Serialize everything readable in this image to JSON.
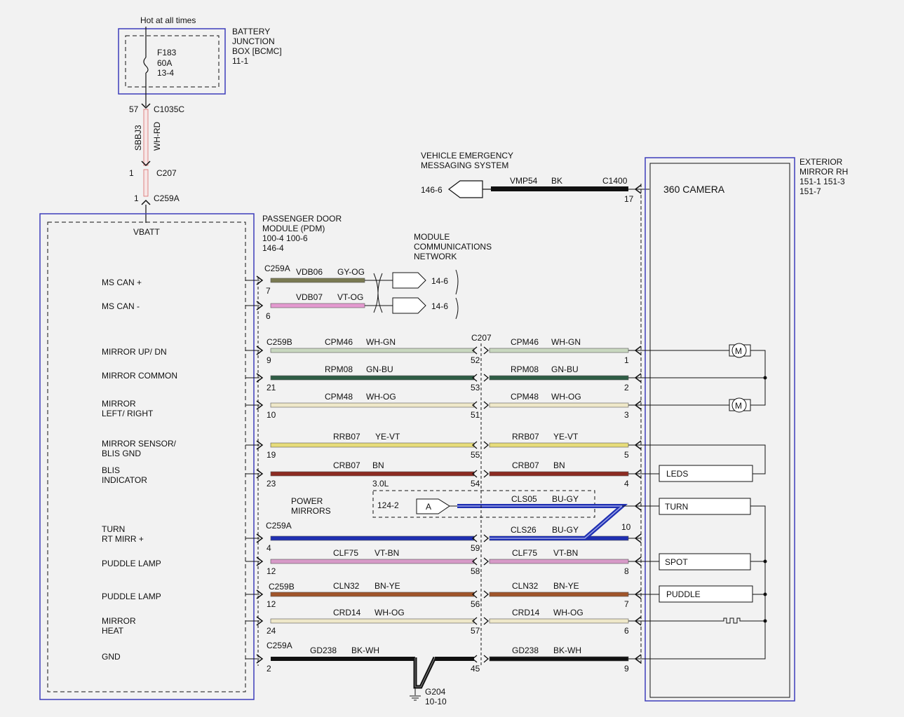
{
  "battery": {
    "hot_label": "Hot at all times",
    "box_title": [
      "BATTERY",
      "JUNCTION",
      "BOX [BCMC]",
      "11-1"
    ],
    "fuse": [
      "F183",
      "60A",
      "13-4"
    ]
  },
  "feed": {
    "pin_top": "57",
    "connector_top": "C1035C",
    "circuit": "SBBJ3",
    "color": "WH-RD",
    "pin_mid": "1",
    "connector_mid": "C207",
    "pin_bot": "1",
    "connector_bot": "C259A"
  },
  "pdm": {
    "title": [
      "PASSENGER DOOR",
      "MODULE (PDM)",
      "100-4   100-6",
      "146-4"
    ],
    "vbatt": "VBATT",
    "signals": [
      [
        "MS CAN +"
      ],
      [
        "MS CAN -"
      ],
      [
        "MIRROR UP/ DN"
      ],
      [
        "MIRROR COMMON"
      ],
      [
        "MIRROR",
        "LEFT/ RIGHT"
      ],
      [
        "MIRROR SENSOR/",
        "BLIS GND"
      ],
      [
        "BLIS",
        "INDICATOR"
      ],
      [
        "TURN",
        "RT MIRR +"
      ],
      [
        "PUDDLE LAMP"
      ],
      [
        "PUDDLE LAMP"
      ],
      [
        "MIRROR",
        "HEAT"
      ],
      [
        "GND"
      ]
    ]
  },
  "mcn": {
    "title": [
      "MODULE",
      "COMMUNICATIONS",
      "NETWORK"
    ],
    "connector": "C259A",
    "lines": [
      {
        "circuit": "VDB06",
        "color": "GY-OG",
        "pin": "7",
        "ref": "14-6"
      },
      {
        "circuit": "VDB07",
        "color": "VT-OG",
        "pin": "6",
        "ref": "14-6"
      }
    ]
  },
  "vems": {
    "title": [
      "VEHICLE EMERGENCY",
      "MESSAGING SYSTEM"
    ],
    "ref": "146-6",
    "circuit": "VMP54",
    "color": "BK",
    "connector": "C1400",
    "pin": "17"
  },
  "mirror": {
    "title": [
      "EXTERIOR",
      "MIRROR RH",
      "151-1   151-3",
      "151-7"
    ],
    "camera": "360 CAMERA",
    "leds": "LEDS",
    "turn": "TURN",
    "spot": "SPOT",
    "puddle": "PUDDLE",
    "motor": "M"
  },
  "connectors": {
    "c259b_top": "C259B",
    "c207": "C207",
    "c259a_turn": "C259A",
    "c259b_puddle": "C259B",
    "c259a_gnd": "C259A"
  },
  "wires": [
    {
      "circuit": "CPM46",
      "color": "WH-GN",
      "pin_left": "9",
      "pin_mid": "52",
      "pin_right": "1"
    },
    {
      "circuit": "RPM08",
      "color": "GN-BU",
      "pin_left": "21",
      "pin_mid": "53",
      "pin_right": "2"
    },
    {
      "circuit": "CPM48",
      "color": "WH-OG",
      "pin_left": "10",
      "pin_mid": "51",
      "pin_right": "3"
    },
    {
      "circuit": "RRB07",
      "color": "YE-VT",
      "pin_left": "19",
      "pin_mid": "55",
      "pin_right": "5"
    },
    {
      "circuit": "CRB07",
      "color": "BN",
      "pin_left": "23",
      "pin_mid": "54",
      "pin_right": "4",
      "note": "3.0L"
    },
    {
      "circuit": "CLS26",
      "color": "BU-GY",
      "pin_left": "4",
      "pin_mid": "59",
      "pin_right": "10",
      "left_circuit": "",
      "left_color": ""
    },
    {
      "circuit": "CLF75",
      "color": "VT-BN",
      "pin_left": "12",
      "pin_mid": "58",
      "pin_right": "8"
    },
    {
      "circuit": "CLN32",
      "color": "BN-YE",
      "pin_left": "12",
      "pin_mid": "56",
      "pin_right": "7"
    },
    {
      "circuit": "CRD14",
      "color": "WH-OG",
      "pin_left": "24",
      "pin_mid": "57",
      "pin_right": "6"
    },
    {
      "circuit": "GD238",
      "color": "BK-WH",
      "pin_left": "2",
      "pin_mid": "45",
      "pin_right": "9"
    }
  ],
  "power_mirrors": {
    "title": [
      "POWER",
      "MIRRORS"
    ],
    "ref": "124-2",
    "connector_label": "A",
    "circuit": "CLS05",
    "color": "BU-GY"
  },
  "ground": {
    "name": "G204",
    "ref": "10-10"
  },
  "colors": {
    "frame": "#3d3dbb",
    "wh_gn": "#c9d8c0",
    "gn_bu": "#2f5d45",
    "wh_og": "#efe8c9",
    "ye_vt": "#e7dc7a",
    "bn": "#8c2b22",
    "bu_gy": "#1f2fb2",
    "vt_bn": "#d79ac8",
    "bn_ye": "#a0552a",
    "bk_wh": "#111111",
    "gy_og": "#7a7a52",
    "vt_og": "#e49ad0"
  }
}
